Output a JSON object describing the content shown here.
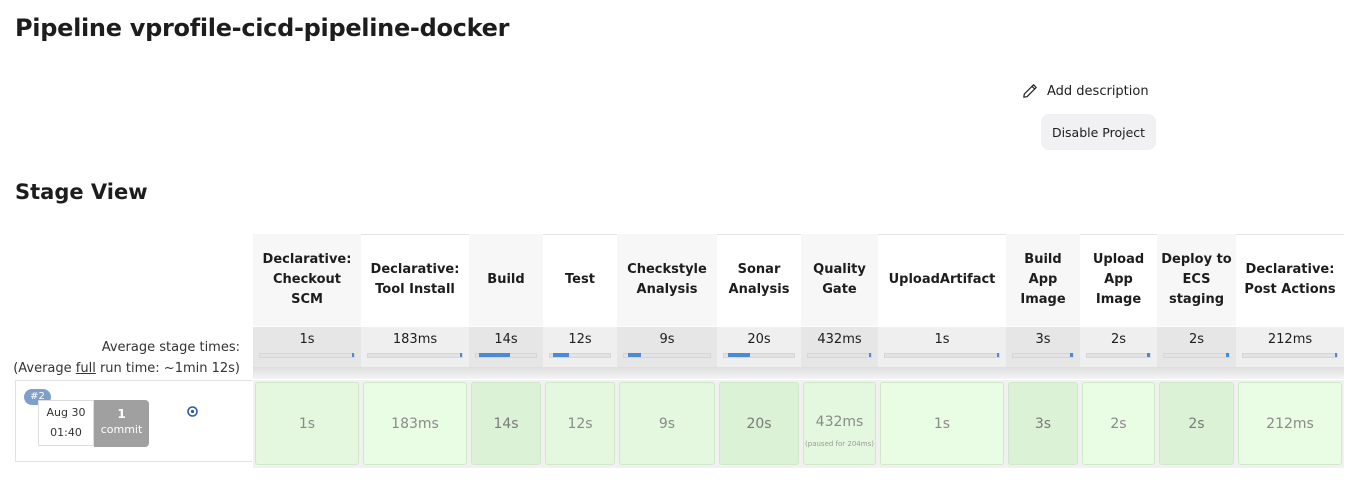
{
  "page": {
    "title": "Pipeline vprofile-cicd-pipeline-docker",
    "add_description": "Add description",
    "disable_project": "Disable Project",
    "stage_view_title": "Stage View"
  },
  "stage_view": {
    "average_label_1": "Average stage times:",
    "average_label_2a": "(Average ",
    "average_label_2b": "full",
    "average_label_2c": " run time: ~1min 12s)",
    "stages": [
      {
        "name": "Declarative: Checkout SCM",
        "avg": "1s",
        "bar": 0.0
      },
      {
        "name": "Declarative: Tool Install",
        "avg": "183ms",
        "bar": 0.0
      },
      {
        "name": "Build",
        "avg": "14s",
        "bar": 0.5
      },
      {
        "name": "Test",
        "avg": "12s",
        "bar": 0.25
      },
      {
        "name": "Checkstyle Analysis",
        "avg": "9s",
        "bar": 0.15
      },
      {
        "name": "Sonar Analysis",
        "avg": "20s",
        "bar": 0.3
      },
      {
        "name": "Quality Gate",
        "avg": "432ms",
        "bar": 0.02
      },
      {
        "name": "UploadArtifact",
        "avg": "1s",
        "bar": 0.02
      },
      {
        "name": "Build App Image",
        "avg": "3s",
        "bar": 0.05
      },
      {
        "name": "Upload App Image",
        "avg": "2s",
        "bar": 0.04
      },
      {
        "name": "Deploy to ECS staging",
        "avg": "2s",
        "bar": 0.04
      },
      {
        "name": "Declarative: Post Actions",
        "avg": "212ms",
        "bar": 0.0
      }
    ],
    "build": {
      "number": "#2",
      "date": "Aug 30",
      "time": "01:40",
      "commits_count": "1",
      "commits_label": "commit",
      "results": [
        "1s",
        "183ms",
        "14s",
        "12s",
        "9s",
        "20s",
        "432ms",
        "1s",
        "3s",
        "2s",
        "2s",
        "212ms"
      ],
      "quality_gate_note": "(paused for 204ms)"
    }
  },
  "colors": {
    "success": "#e3f8de",
    "bar": "#4a8bd8",
    "badge": "#7e9fc8"
  }
}
